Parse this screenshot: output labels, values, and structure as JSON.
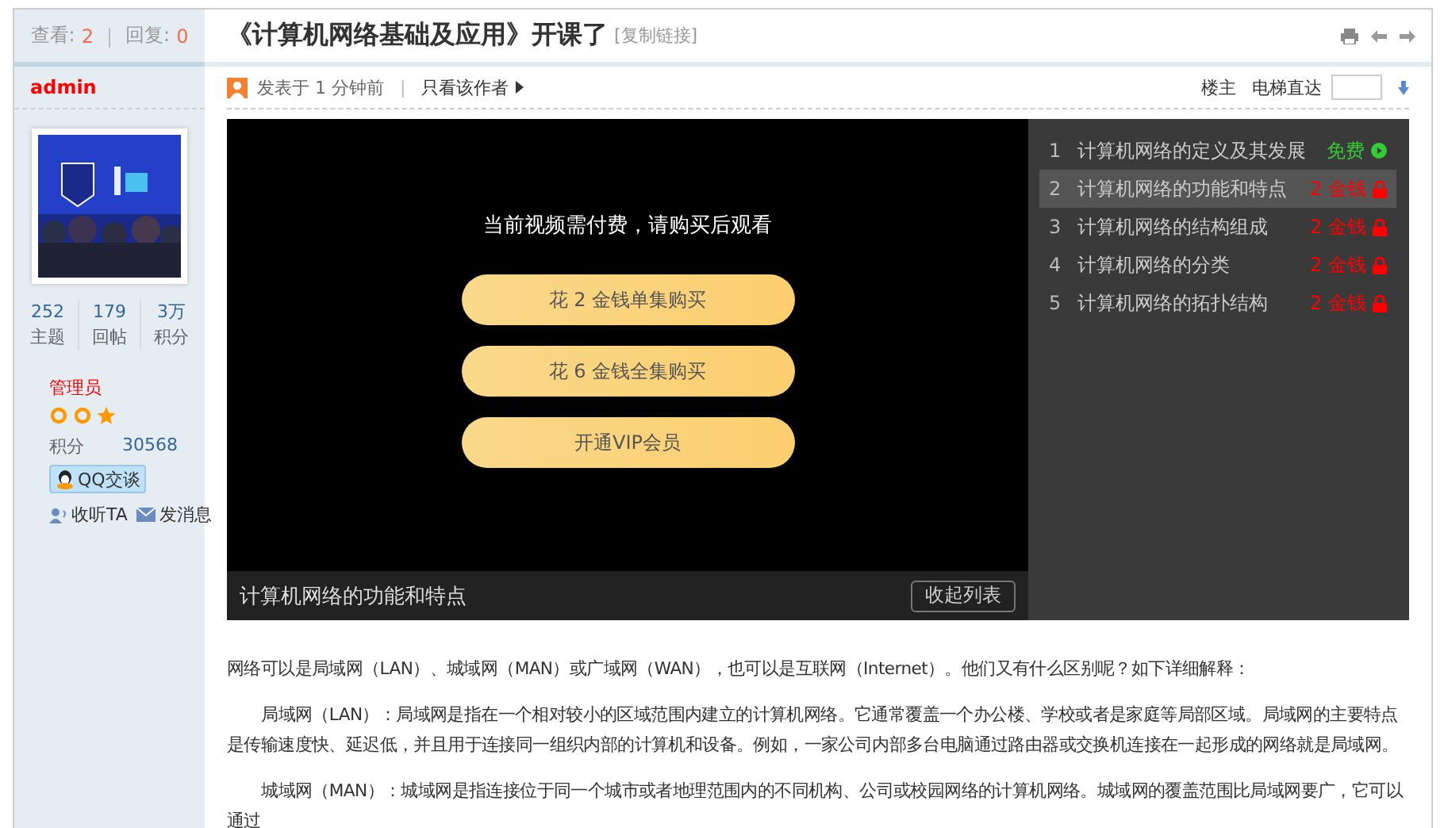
{
  "sidebar": {
    "views_label": "查看:",
    "views": "2",
    "separator": "|",
    "replies_label": "回复:",
    "replies": "0",
    "username": "admin",
    "stats": [
      {
        "value": "252",
        "label": "主题"
      },
      {
        "value": "179",
        "label": "回帖"
      },
      {
        "value": "3万",
        "label": "积分"
      }
    ],
    "group": "管理员",
    "points_label": "积分",
    "points": "30568",
    "qq_button": "QQ交谈",
    "actions": [
      {
        "kind": "follow",
        "label": "收听TA"
      },
      {
        "kind": "message",
        "label": "发消息"
      }
    ]
  },
  "post": {
    "title": "《计算机网络基础及应用》开课了",
    "copy_link": "[复制链接]",
    "posted": "发表于 1 分钟前",
    "separator": "|",
    "author_only": "只看该作者",
    "floor": "楼主",
    "jump_label": "电梯直达"
  },
  "player": {
    "prompt": "当前视频需付费，请购买后观看",
    "buy_buttons": [
      "花 2 金钱单集购买",
      "花 6 金钱全集购买",
      "开通VIP会员"
    ],
    "current_title": "计算机网络的功能和特点",
    "collapse_button": "收起列表",
    "playlist": [
      {
        "index": "1",
        "title": "计算机网络的定义及其发展",
        "price": "免费",
        "kind": "free",
        "selected": false
      },
      {
        "index": "2",
        "title": "计算机网络的功能和特点",
        "price": "2 金钱",
        "kind": "paid",
        "selected": true
      },
      {
        "index": "3",
        "title": "计算机网络的结构组成",
        "price": "2 金钱",
        "kind": "paid",
        "selected": false
      },
      {
        "index": "4",
        "title": "计算机网络的分类",
        "price": "2 金钱",
        "kind": "paid",
        "selected": false
      },
      {
        "index": "5",
        "title": "计算机网络的拓扑结构",
        "price": "2 金钱",
        "kind": "paid",
        "selected": false
      }
    ]
  },
  "paragraphs": [
    {
      "indent": false,
      "text": "网络可以是局域网（LAN）、城域网（MAN）或广域网（WAN），也可以是互联网（Internet）。他们又有什么区别呢？如下详细解释："
    },
    {
      "indent": true,
      "text": "局域网（LAN）：局域网是指在一个相对较小的区域范围内建立的计算机网络。它通常覆盖一个办公楼、学校或者是家庭等局部区域。局域网的主要特点是传输速度快、延迟低，并且用于连接同一组织内部的计算机和设备。例如，一家公司内部多台电脑通过路由器或交换机连接在一起形成的网络就是局域网。"
    },
    {
      "indent": true,
      "text": "城域网（MAN）：城域网是指连接位于同一个城市或者地理范围内的不同机构、公司或校园网络的计算机网络。城域网的覆盖范围比局域网要广，它可以通过"
    }
  ]
}
